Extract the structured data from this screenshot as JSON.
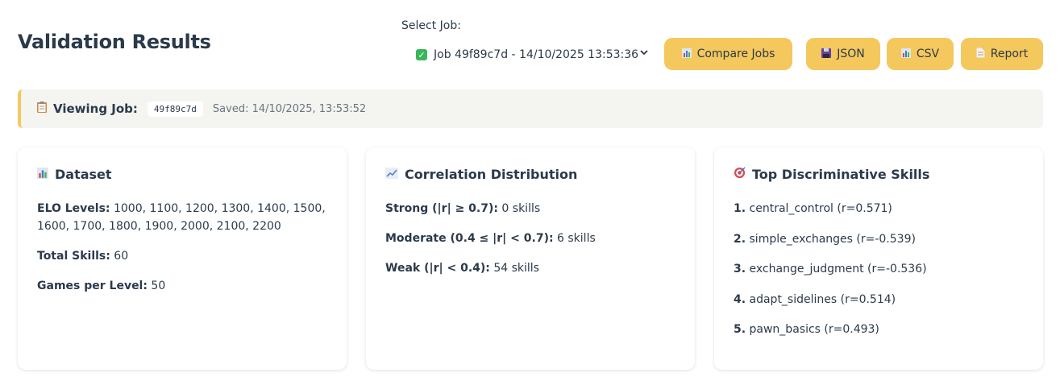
{
  "header": {
    "title": "Validation Results",
    "select_label": "Select Job:",
    "selected_job": "Job 49f89c7d - 14/10/2025 13:53:36"
  },
  "toolbar": {
    "compare_label": "Compare Jobs",
    "json_label": "JSON",
    "csv_label": "CSV",
    "report_label": "Report"
  },
  "banner": {
    "label": "Viewing Job:",
    "job_id": "49f89c7d",
    "saved": "Saved: 14/10/2025, 13:53:52"
  },
  "dataset": {
    "title": "Dataset",
    "elo_label": "ELO Levels:",
    "elo_value": "1000, 1100, 1200, 1300, 1400, 1500, 1600, 1700, 1800, 1900, 2000, 2100, 2200",
    "skills_label": "Total Skills:",
    "skills_value": "60",
    "games_label": "Games per Level:",
    "games_value": "50"
  },
  "correlation": {
    "title": "Correlation Distribution",
    "strong_label": "Strong (|r| ≥ 0.7):",
    "strong_value": "0 skills",
    "moderate_label": "Moderate (0.4 ≤ |r| < 0.7):",
    "moderate_value": "6 skills",
    "weak_label": "Weak (|r| < 0.4):",
    "weak_value": "54 skills"
  },
  "top_skills": {
    "title": "Top Discriminative Skills",
    "items": [
      {
        "rank": "1.",
        "text": "central_control (r=0.571)"
      },
      {
        "rank": "2.",
        "text": "simple_exchanges (r=-0.539)"
      },
      {
        "rank": "3.",
        "text": "exchange_judgment (r=-0.536)"
      },
      {
        "rank": "4.",
        "text": "adapt_sidelines (r=0.514)"
      },
      {
        "rank": "5.",
        "text": "pawn_basics (r=0.493)"
      }
    ]
  },
  "colors": {
    "accent": "#f4c85c",
    "banner_bg": "#f4f4f0",
    "text": "#2b3a4a"
  },
  "icons": {
    "compare": "bar-chart-icon",
    "json": "floppy-disk-icon",
    "csv": "bar-chart-icon",
    "report": "document-icon",
    "banner": "clipboard-icon",
    "dataset": "bar-chart-icon",
    "correlation": "trend-chart-icon",
    "top_skills": "target-icon"
  }
}
